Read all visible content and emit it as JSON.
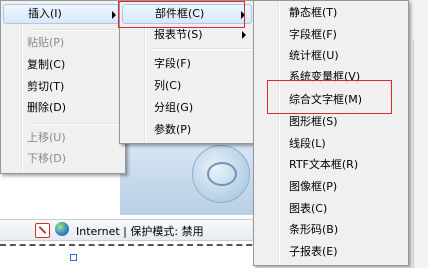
{
  "status_bar": {
    "text": "Internet | 保护模式: 禁用",
    "blocked_icon": "blocked-icon",
    "globe_icon": "globe-icon"
  },
  "menu_edit": {
    "items": [
      {
        "label": "插入(I)",
        "submenu": true,
        "highlighted": true
      },
      {
        "label": "粘贴(P)",
        "disabled": true
      },
      {
        "label": "复制(C)"
      },
      {
        "label": "剪切(T)"
      },
      {
        "label": "删除(D)"
      },
      {
        "label": "上移(U)",
        "disabled": true
      },
      {
        "label": "下移(D)",
        "disabled": true
      }
    ]
  },
  "menu_insert": {
    "items": [
      {
        "label": "部件框(C)",
        "submenu": true,
        "highlighted": true
      },
      {
        "label": "报表节(S)",
        "submenu": true
      },
      {
        "label": "字段(F)"
      },
      {
        "label": "列(C)"
      },
      {
        "label": "分组(G)"
      },
      {
        "label": "参数(P)"
      }
    ]
  },
  "menu_components": {
    "items": [
      {
        "label": "静态框(T)"
      },
      {
        "label": "字段框(F)"
      },
      {
        "label": "统计框(U)"
      },
      {
        "label": "系统变量框(V)"
      },
      {
        "label": "综合文字框(M)",
        "annotated": true
      },
      {
        "label": "图形框(S)"
      },
      {
        "label": "线段(L)"
      },
      {
        "label": "RTF文本框(R)"
      },
      {
        "label": "图像框(P)"
      },
      {
        "label": "图表(C)"
      },
      {
        "label": "条形码(B)"
      },
      {
        "label": "子报表(E)"
      }
    ]
  },
  "colors": {
    "annotation": "#e0252b",
    "menu_bg": "#f0f0f0",
    "highlight": "#d8e8f9"
  }
}
